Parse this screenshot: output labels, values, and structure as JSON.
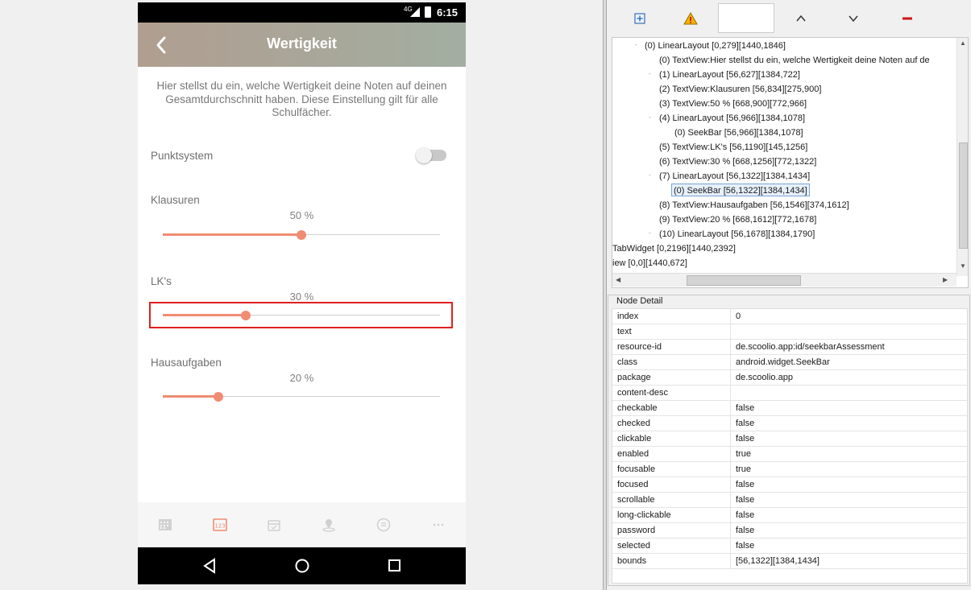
{
  "device": {
    "status_bar": {
      "network": "4G",
      "time": "6:15"
    },
    "app_bar": {
      "back_icon": "chevron-left-icon",
      "title": "Wertigkeit"
    },
    "intro_text": "Hier stellst du ein, welche Wertigkeit deine Noten auf deinen Gesamtdurchschnitt haben. Diese Einstellung gilt für alle Schulfächer.",
    "punktsystem": {
      "label": "Punktsystem",
      "enabled": false
    },
    "weights": [
      {
        "label": "Klausuren",
        "percent_label": "50 %",
        "value": 0.5
      },
      {
        "label": "LK's",
        "percent_label": "30 %",
        "value": 0.3
      },
      {
        "label": "Hausaufgaben",
        "percent_label": "20 %",
        "value": 0.2
      }
    ],
    "highlighted_weight": "LK's",
    "accent_color": "#f08c72",
    "bottom_nav": [
      "calendar-grid-icon",
      "grades-icon",
      "archive-icon",
      "location-icon",
      "chat-icon",
      "more-icon"
    ],
    "bottom_nav_active": "grades-icon",
    "system_nav": [
      "back-triangle-icon",
      "home-circle-icon",
      "recents-square-icon"
    ]
  },
  "inspector": {
    "toolbar": [
      "expand-icon",
      "warning-icon",
      "search-field",
      "arrow-up-icon",
      "arrow-down-icon",
      "collapse-icon"
    ],
    "tree": [
      "(0) LinearLayout [0,279][1440,1846]",
      "(0) TextView:Hier stellst du ein, welche Wertigkeit deine Noten auf de",
      "(1) LinearLayout [56,627][1384,722]",
      "(2) TextView:Klausuren [56,834][275,900]",
      "(3) TextView:50 % [668,900][772,966]",
      "(4) LinearLayout [56,966][1384,1078]",
      "(0) SeekBar [56,966][1384,1078]",
      "(5) TextView:LK's [56,1190][145,1256]",
      "(6) TextView:30 % [668,1256][772,1322]",
      "(7) LinearLayout [56,1322][1384,1434]",
      "(0) SeekBar [56,1322][1384,1434]",
      "(8) TextView:Hausaufgaben [56,1546][374,1612]",
      "(9) TextView:20 % [668,1612][772,1678]",
      "(10) LinearLayout [56,1678][1384,1790]",
      "TabWidget [0,2196][1440,2392]",
      "iew [0,0][1440,672]"
    ],
    "selected_tree_item": "(0) SeekBar [56,1322][1384,1434]",
    "detail": {
      "title": "Node Detail",
      "rows": [
        {
          "key": "index",
          "value": "0"
        },
        {
          "key": "text",
          "value": ""
        },
        {
          "key": "resource-id",
          "value": "de.scoolio.app:id/seekbarAssessment"
        },
        {
          "key": "class",
          "value": "android.widget.SeekBar"
        },
        {
          "key": "package",
          "value": "de.scoolio.app"
        },
        {
          "key": "content-desc",
          "value": ""
        },
        {
          "key": "checkable",
          "value": "false"
        },
        {
          "key": "checked",
          "value": "false"
        },
        {
          "key": "clickable",
          "value": "false"
        },
        {
          "key": "enabled",
          "value": "true"
        },
        {
          "key": "focusable",
          "value": "true"
        },
        {
          "key": "focused",
          "value": "false"
        },
        {
          "key": "scrollable",
          "value": "false"
        },
        {
          "key": "long-clickable",
          "value": "false"
        },
        {
          "key": "password",
          "value": "false"
        },
        {
          "key": "selected",
          "value": "false"
        },
        {
          "key": "bounds",
          "value": "[56,1322][1384,1434]"
        }
      ]
    }
  }
}
